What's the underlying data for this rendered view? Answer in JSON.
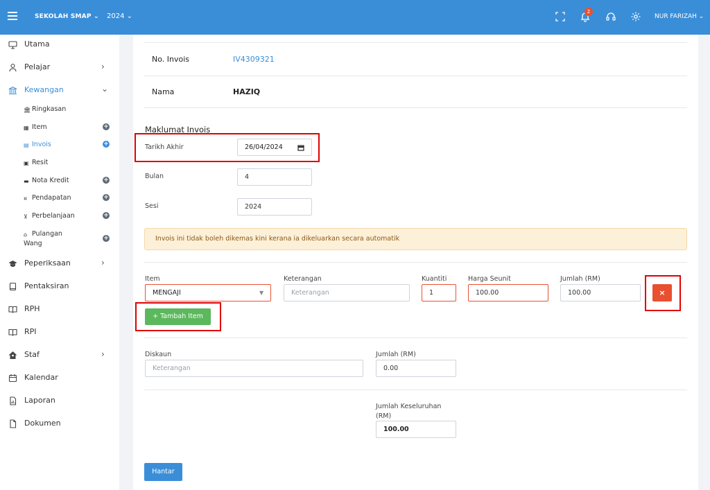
{
  "topbar": {
    "school": "SEKOLAH SMAP ⌄",
    "year": "2024 ⌄",
    "notification_count": "2",
    "user": "NUR FARIZAH ⌄"
  },
  "sidebar": {
    "items": [
      {
        "label": "Utama",
        "icon": "monitor-icon"
      },
      {
        "label": "Pelajar",
        "icon": "user-icon"
      },
      {
        "label": "Kewangan",
        "icon": "bank-icon"
      },
      {
        "label": "Peperiksaan",
        "icon": "graduation-cap-icon"
      },
      {
        "label": "Pentaksiran",
        "icon": "book-icon"
      },
      {
        "label": "RPH",
        "icon": "open-book-icon"
      },
      {
        "label": "RPI",
        "icon": "open-book-icon"
      },
      {
        "label": "Staf",
        "icon": "house-user-icon"
      },
      {
        "label": "Kalendar",
        "icon": "calendar-icon"
      },
      {
        "label": "Laporan",
        "icon": "report-icon"
      },
      {
        "label": "Dokumen",
        "icon": "document-icon"
      }
    ],
    "sub_items": [
      {
        "label": "Ringkasan",
        "icon": "bank-icon"
      },
      {
        "label": "Item",
        "icon": "grid-icon"
      },
      {
        "label": "Invois",
        "icon": "invoice-icon"
      },
      {
        "label": "Resit",
        "icon": "receipt-icon"
      },
      {
        "label": "Nota Kredit",
        "icon": "card-icon"
      },
      {
        "label": "Pendapatan",
        "icon": "money-icon"
      },
      {
        "label": "Perbelanjaan",
        "icon": "cart-icon"
      },
      {
        "label": "Pulangan",
        "label2": "Wang",
        "icon": "refund-icon"
      }
    ]
  },
  "invoice": {
    "no_label": "No. Invois",
    "no_value": "IV4309321",
    "name_label": "Nama",
    "name_value": "HAZIQ"
  },
  "form": {
    "section_title": "Maklumat Invois",
    "due_label": "Tarikh Akhir",
    "due_value": "26/04/2024",
    "month_label": "Bulan",
    "month_value": "4",
    "session_label": "Sesi",
    "session_value": "2024",
    "alert": "Invois ini tidak boleh dikemas kini kerana ia dikeluarkan secara automatik"
  },
  "items": {
    "item_label": "Item",
    "item_value": "MENGAJI",
    "desc_label": "Keterangan",
    "desc_placeholder": "Keterangan",
    "qty_label": "Kuantiti",
    "qty_value": "1",
    "price_label": "Harga Seunit",
    "price_value": "100.00",
    "total_label": "Jumlah (RM)",
    "total_value": "100.00",
    "remove_label": "×",
    "add_label": "+ Tambah Item"
  },
  "discount": {
    "label": "Diskaun",
    "placeholder": "Keterangan",
    "amount_label": "Jumlah (RM)",
    "amount_value": "0.00"
  },
  "grand": {
    "label_line1": "Jumlah Keseluruhan",
    "label_line2": "(RM)",
    "value": "100.00"
  },
  "submit_label": "Hantar",
  "colors": {
    "primary": "#3a8ed8",
    "success": "#5cb85c",
    "danger": "#e8502f",
    "highlight": "#e00000"
  }
}
